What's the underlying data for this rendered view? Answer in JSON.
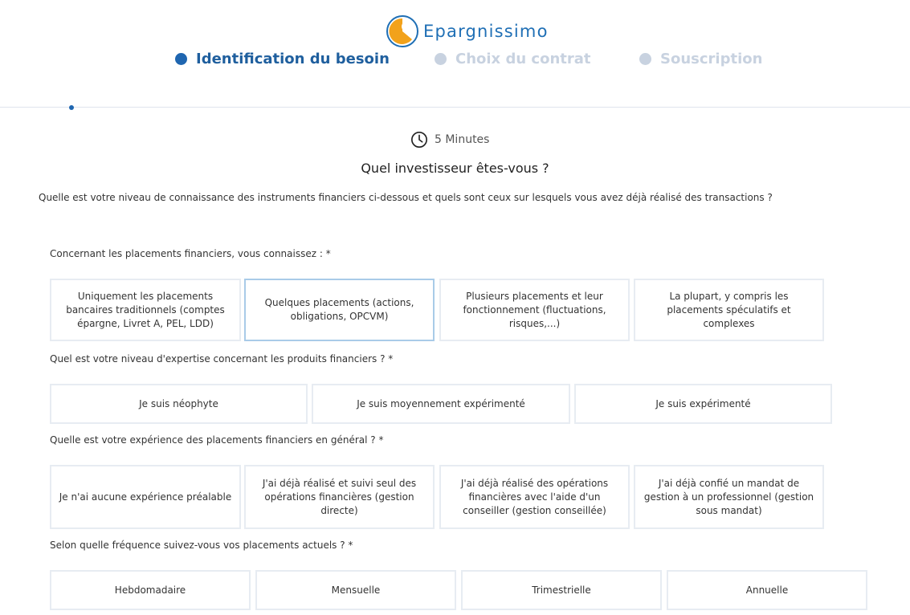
{
  "brand": {
    "name": "Epargnissimo"
  },
  "steps": [
    {
      "label": "Identification du besoin",
      "state": "active"
    },
    {
      "label": "Choix du contrat",
      "state": "inactive"
    },
    {
      "label": "Souscription",
      "state": "inactive"
    }
  ],
  "duration": {
    "icon": "clock-icon",
    "label": "5 Minutes"
  },
  "page": {
    "title": "Quel investisseur êtes-vous ?",
    "intro": "Quelle est votre niveau de connaissance des instruments financiers ci-dessous et quels sont ceux sur lesquels vous avez déjà réalisé des transactions ?"
  },
  "questions": [
    {
      "label": "Concernant les placements financiers, vous connaissez : *",
      "options": [
        "Uniquement les placements bancaires traditionnels (comptes épargne, Livret A, PEL, LDD)",
        "Quelques placements (actions, obligations, OPCVM)",
        "Plusieurs placements et leur fonctionnement (fluctuations, risques,...)",
        "La plupart, y compris les placements spéculatifs et complexes"
      ]
    },
    {
      "label": "Quel est votre niveau d'expertise concernant les produits financiers ? *",
      "options": [
        "Je suis néophyte",
        "Je suis moyennement expérimenté",
        "Je suis expérimenté"
      ]
    },
    {
      "label": "Quelle est votre expérience des placements financiers en général ? *",
      "options": [
        "Je n'ai aucune expérience préalable",
        "J'ai déjà réalisé et suivi seul des opérations financières (gestion directe)",
        "J'ai déjà réalisé des opérations financières avec l'aide d'un conseiller (gestion conseillée)",
        "J'ai déjà confié un mandat de gestion à un professionnel (gestion sous mandat)"
      ]
    },
    {
      "label": "Selon quelle fréquence suivez-vous vos placements actuels ? *",
      "options": [
        "Hebdomadaire",
        "Mensuelle",
        "Trimestrielle",
        "Annuelle"
      ]
    }
  ],
  "colors": {
    "accent": "#1f66b0",
    "inactive": "#c8d2e0",
    "border": "#e7ecf2",
    "selected_border": "#a9cbe8"
  }
}
